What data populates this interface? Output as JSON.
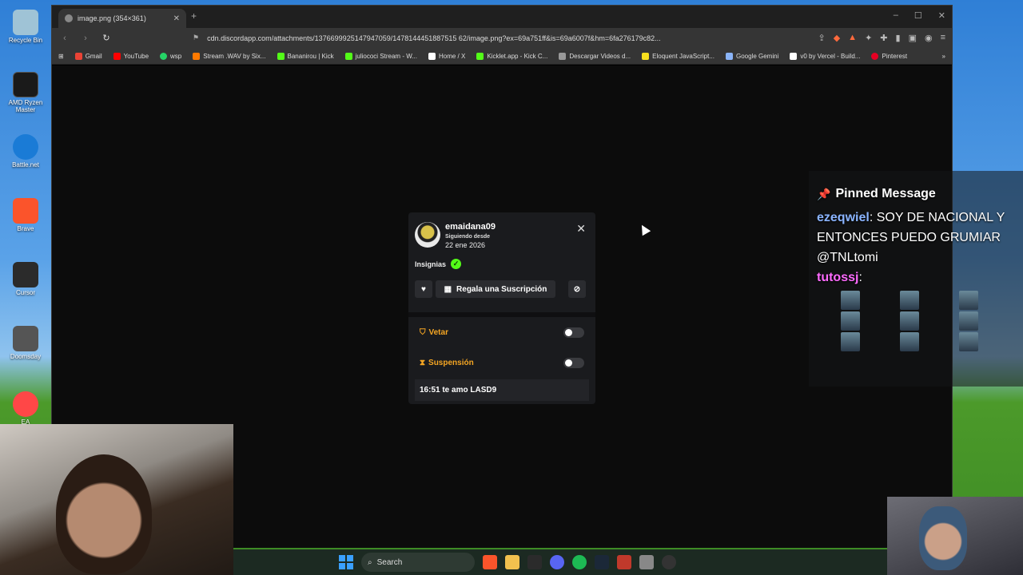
{
  "desktop": {
    "icons": [
      {
        "label": "Recycle Bin",
        "color": "#9fc3d6"
      },
      {
        "label": "AMD Ryzen Master",
        "color": "#1a1a1a"
      },
      {
        "label": "Battle.net",
        "color": "#1a7bd6"
      },
      {
        "label": "Brave",
        "color": "#fb542b"
      },
      {
        "label": "Cursor",
        "color": "#2b2b2b"
      },
      {
        "label": "Doomsday",
        "color": "#555555"
      },
      {
        "label": "EA",
        "color": "#ff4747"
      }
    ]
  },
  "browser": {
    "tab_title": "image.png (354×361)",
    "new_tab": "+",
    "url": "cdn.discordapp.com/attachments/1376699925147947059/1478144451887515 62/image.png?ex=69a751ff&is=69a6007f&hm=6fa276179c82...",
    "bookmarks": [
      {
        "label": "Gmail",
        "color": "#ea4335"
      },
      {
        "label": "YouTube",
        "color": "#ff0000"
      },
      {
        "label": "wsp",
        "color": "#25d366"
      },
      {
        "label": "Stream .WAV by Six...",
        "color": "#ff7a00"
      },
      {
        "label": "Bananirou | Kick",
        "color": "#53fc18"
      },
      {
        "label": "juliococi Stream - W...",
        "color": "#53fc18"
      },
      {
        "label": "Home / X",
        "color": "#ffffff"
      },
      {
        "label": "Kicklet.app - Kick C...",
        "color": "#53fc18"
      },
      {
        "label": "Descargar Videos d...",
        "color": "#999999"
      },
      {
        "label": "Eloquent JavaScript...",
        "color": "#f7df1e"
      },
      {
        "label": "Google Gemini",
        "color": "#8ab4f8"
      },
      {
        "label": "v0 by Vercel - Build...",
        "color": "#ffffff"
      },
      {
        "label": "Pinterest",
        "color": "#e60023"
      }
    ]
  },
  "card": {
    "username": "emaidana09",
    "since_label": "Siguiendo desde",
    "since_date": "22 ene 2026",
    "badges_label": "Insignias",
    "gift_label": "Regala una Suscripción",
    "veto_label": "Vetar",
    "suspension_label": "Suspensión",
    "message": "16:51 te amo LASD9"
  },
  "chat_overlay": {
    "pinned_title": "Pinned Message",
    "user1": "ezeqwiel",
    "message1": "SOY DE NACIONAL Y ENTONCES PUEDO GRUMIAR @TNLtomi",
    "user2": "tutossj"
  },
  "taskbar": {
    "search_label": "Search"
  }
}
